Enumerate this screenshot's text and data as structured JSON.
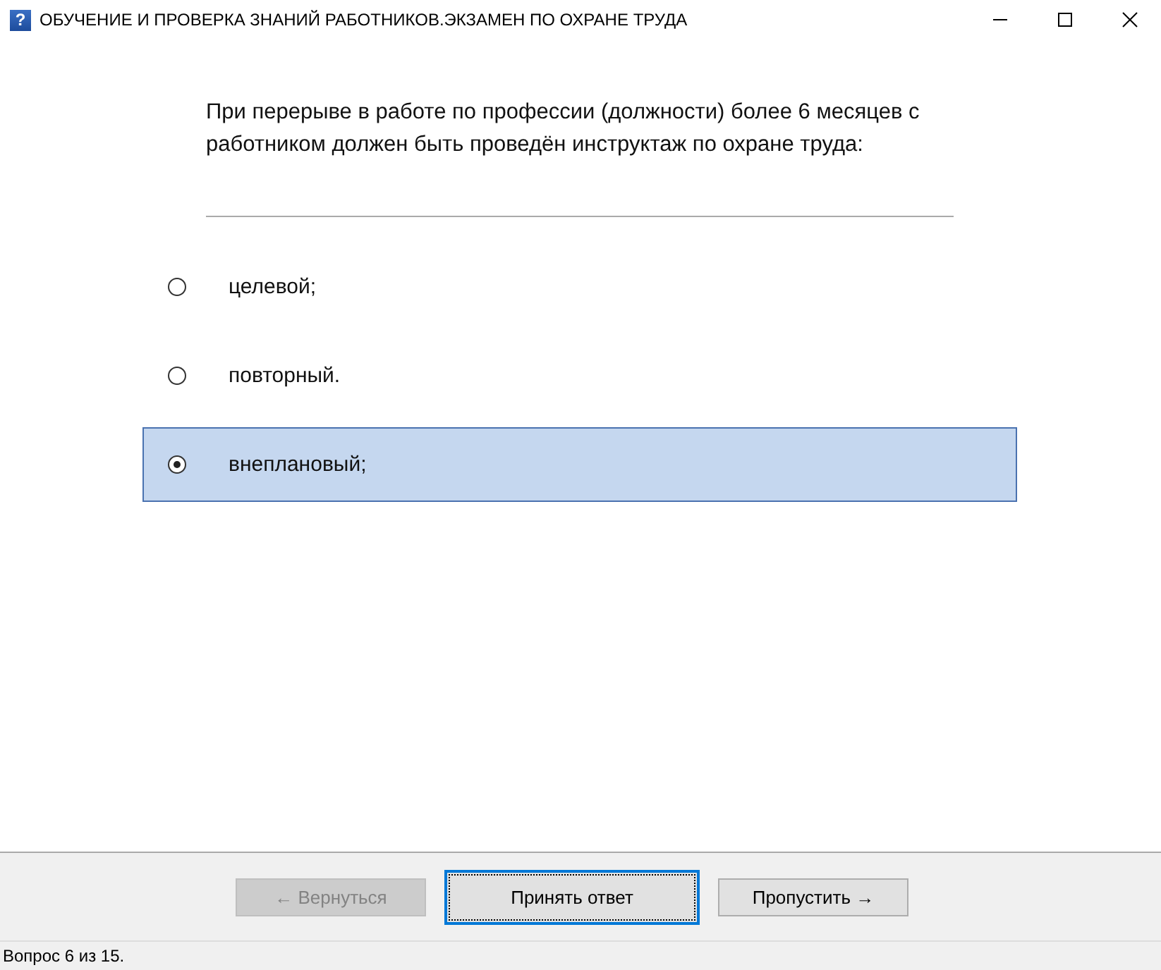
{
  "window": {
    "icon": "?",
    "title": "ОБУЧЕНИЕ И ПРОВЕРКА ЗНАНИЙ РАБОТНИКОВ.ЭКЗАМЕН ПО ОХРАНЕ ТРУДА"
  },
  "question": "При перерыве в работе по профессии (должности) более 6 месяцев с работником должен быть проведён инструктаж по охране труда:",
  "options": [
    {
      "label": "целевой;",
      "selected": false
    },
    {
      "label": "повторный.",
      "selected": false
    },
    {
      "label": "внеплановый;",
      "selected": true
    }
  ],
  "buttons": [
    {
      "label": "← Вернуться",
      "disabled": true,
      "focused": false
    },
    {
      "label": "Принять ответ",
      "disabled": false,
      "focused": true
    },
    {
      "label": "Пропустить →",
      "disabled": false,
      "focused": false
    }
  ],
  "status_bar": "Вопрос 6 из 15."
}
